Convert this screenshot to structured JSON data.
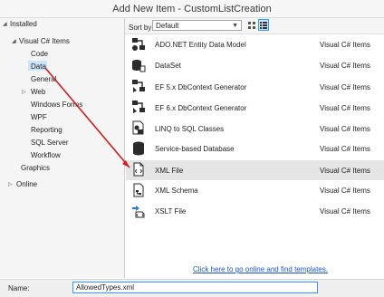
{
  "window": {
    "title": "Add New Item - CustomListCreation"
  },
  "tree": {
    "installed": "Installed",
    "visual_csharp": "Visual C# Items",
    "children": [
      "Code",
      "Data",
      "General",
      "Web",
      "Windows Forms",
      "WPF",
      "Reporting",
      "SQL Server",
      "Workflow"
    ],
    "graphics": "Graphics",
    "online": "Online"
  },
  "toolbar": {
    "sort_label": "Sort by:",
    "sort_value": "Default"
  },
  "items": [
    {
      "name": "ADO.NET Entity Data Model",
      "type": "Visual C# Items",
      "icon": "entity-model-icon"
    },
    {
      "name": "DataSet",
      "type": "Visual C# Items",
      "icon": "dataset-icon"
    },
    {
      "name": "EF 5.x DbContext Generator",
      "type": "Visual C# Items",
      "icon": "ef-generator-icon"
    },
    {
      "name": "EF 6.x DbContext Generator",
      "type": "Visual C# Items",
      "icon": "ef-generator-icon"
    },
    {
      "name": "LINQ to SQL Classes",
      "type": "Visual C# Items",
      "icon": "linq-icon"
    },
    {
      "name": "Service-based Database",
      "type": "Visual C# Items",
      "icon": "database-icon"
    },
    {
      "name": "XML File",
      "type": "Visual C# Items",
      "icon": "xml-file-icon"
    },
    {
      "name": "XML Schema",
      "type": "Visual C# Items",
      "icon": "xml-schema-icon"
    },
    {
      "name": "XSLT File",
      "type": "Visual C# Items",
      "icon": "xslt-file-icon"
    }
  ],
  "online_link": "Click here to go online and find templates.",
  "name_field": {
    "label": "Name:",
    "value": "AllowedTypes.xml"
  },
  "colors": {
    "selection": "#cce4f7",
    "link": "#1b55c8",
    "annotation_arrow": "#cc1f1f"
  }
}
